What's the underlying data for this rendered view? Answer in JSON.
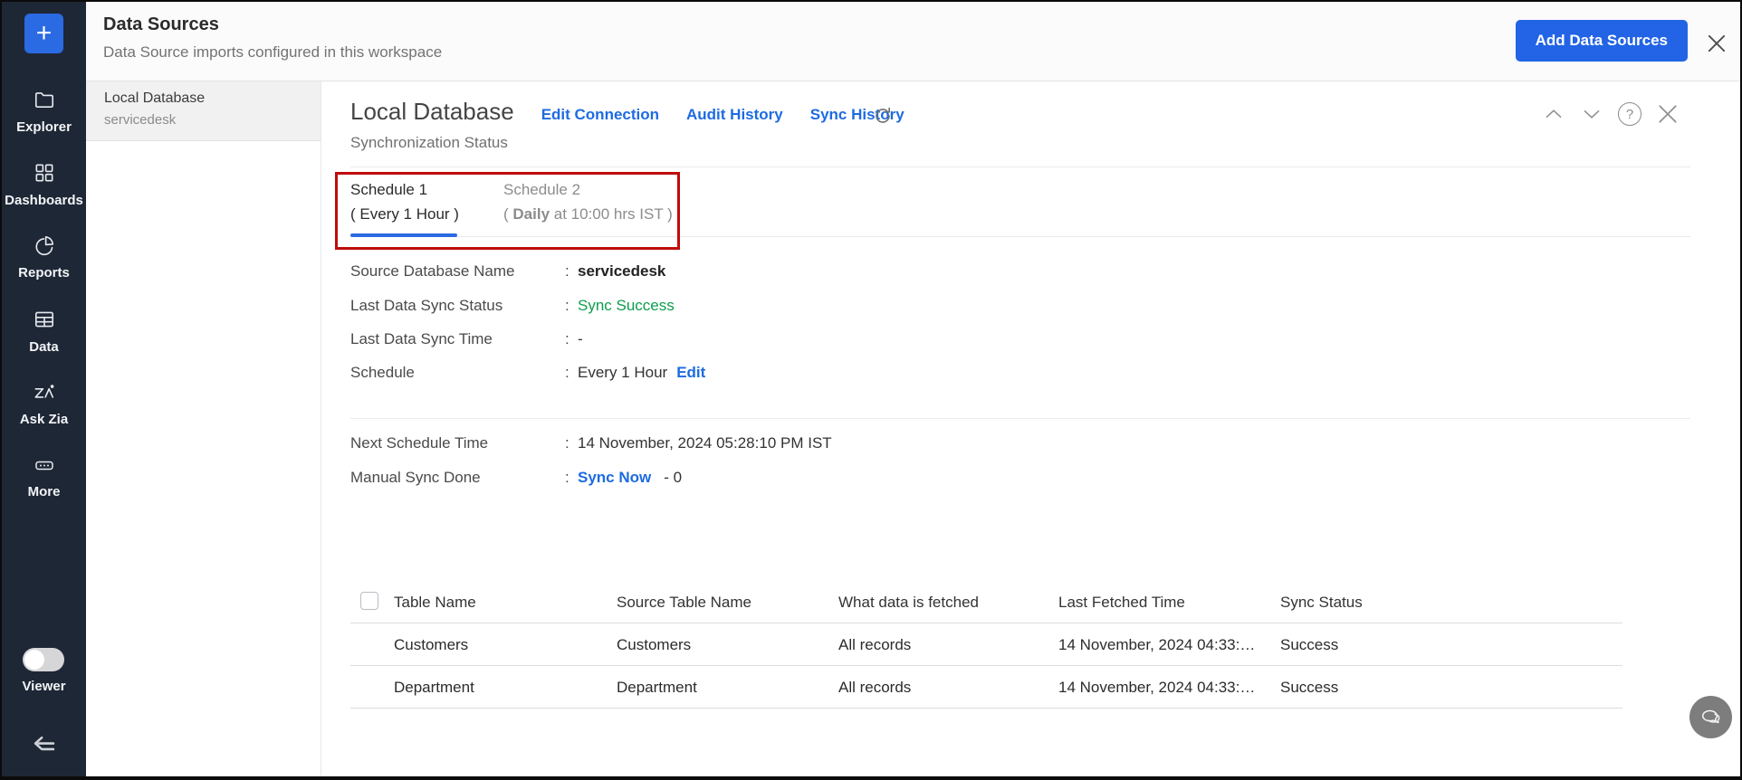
{
  "sidebar": {
    "create_label": "+",
    "items": [
      {
        "label": "Explorer"
      },
      {
        "label": "Dashboards"
      },
      {
        "label": "Reports"
      },
      {
        "label": "Data"
      },
      {
        "label": "Ask Zia"
      },
      {
        "label": "More"
      }
    ],
    "viewer_label": "Viewer"
  },
  "header": {
    "title": "Data Sources",
    "subtitle": "Data Source imports configured in this workspace",
    "add_button_label": "Add Data Sources"
  },
  "source_list": {
    "selected": {
      "name": "Local Database",
      "database": "servicedesk"
    }
  },
  "detail": {
    "title": "Local Database",
    "links": [
      {
        "label": "Edit Connection"
      },
      {
        "label": "Audit History"
      },
      {
        "label": "Sync History"
      }
    ],
    "section_label": "Synchronization Status",
    "separator": ":",
    "help_glyph": "?",
    "tabs": [
      {
        "title": "Schedule 1",
        "subtitle": "( Every 1 Hour )"
      },
      {
        "title": "Schedule 2",
        "subtitle_open": "( ",
        "subtitle_bold": "Daily",
        "subtitle_rest": " at 10:00 hrs IST )"
      }
    ],
    "fields": [
      {
        "label": "Source Database Name",
        "value": "servicedesk"
      },
      {
        "label": "Last Data Sync Status",
        "value": "Sync Success"
      },
      {
        "label": "Last Data Sync Time",
        "value": "-"
      },
      {
        "label": "Schedule",
        "value": "Every 1 Hour",
        "action": "Edit"
      }
    ],
    "schedule_fields": [
      {
        "label": "Next Schedule Time",
        "value": "14 November, 2024 05:28:10 PM IST"
      },
      {
        "label": "Manual Sync Done",
        "action": "Sync Now",
        "value": "- 0"
      }
    ]
  },
  "table": {
    "columns": [
      "Table Name",
      "Source Table Name",
      "What data is fetched",
      "Last Fetched Time",
      "Sync Status"
    ],
    "rows": [
      [
        "Customers",
        "Customers",
        "All records",
        "14 November, 2024 04:33:…",
        "Success"
      ],
      [
        "Department",
        "Department",
        "All records",
        "14 November, 2024 04:33:…",
        "Success"
      ]
    ]
  },
  "colors": {
    "sidebar_bg": "#1e2735",
    "accent_blue": "#2264e5",
    "link_blue": "#1d6be2",
    "active_tab_blue": "#2b6be2",
    "success_green": "#0d9d4d",
    "highlight_red": "#c00b0b"
  }
}
